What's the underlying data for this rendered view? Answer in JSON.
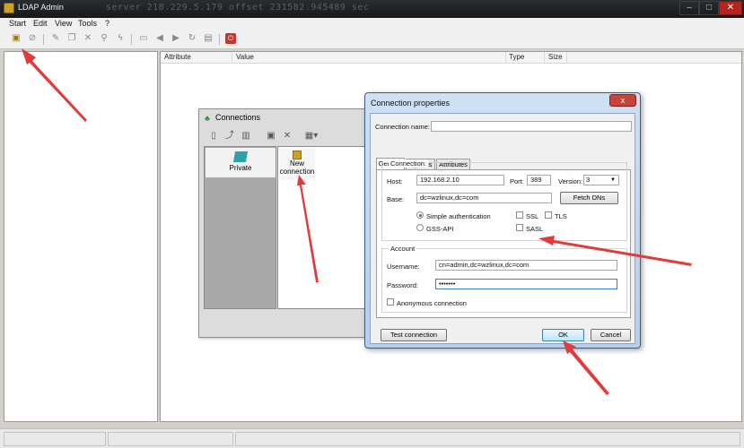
{
  "window": {
    "title": "LDAP Admin",
    "background_text": "server 218.229.5.179 offset 231582.945489 sec"
  },
  "menu": [
    "Start",
    "Edit",
    "View",
    "Tools",
    "?"
  ],
  "grid": {
    "columns": [
      "Attribute",
      "Value",
      "Type",
      "Size"
    ]
  },
  "connections": {
    "title": "Connections",
    "private_label": "Private",
    "new_connection_label": "New connection"
  },
  "dialog": {
    "title": "Connection properties",
    "close_glyph": "x",
    "connection_name_label": "Connection name:",
    "connection_name_value": "",
    "tabs": [
      "General",
      "Options",
      "Attributes"
    ],
    "connection_group": "Connection:",
    "host_label": "Host:",
    "host_value": "192.168.2.10",
    "port_label": "Port:",
    "port_value": "389",
    "version_label": "Version:",
    "version_value": "3",
    "base_label": "Base:",
    "base_value": "dc=wzlinux,dc=com",
    "fetch_dns": "Fetch DNs",
    "simple_auth": "Simple authentication",
    "gss_api": "GSS-API",
    "ssl": "SSL",
    "tls": "TLS",
    "sasl": "SASL",
    "account_group": "Account",
    "username_label": "Username:",
    "username_value": "cn=admin,dc=wzlinux,dc=com",
    "password_label": "Password:",
    "password_value": "•••••••",
    "anonymous": "Anonymous connection",
    "test_connection": "Test connection",
    "ok": "OK",
    "cancel": "Cancel"
  },
  "colors": {
    "annotation_arrow": "#e23b3b",
    "title_bar": "#1d1f22"
  },
  "icons": [
    "new-connection-icon",
    "disconnect-icon",
    "refresh-icon",
    "delete-icon",
    "search-icon",
    "lightning-icon"
  ]
}
